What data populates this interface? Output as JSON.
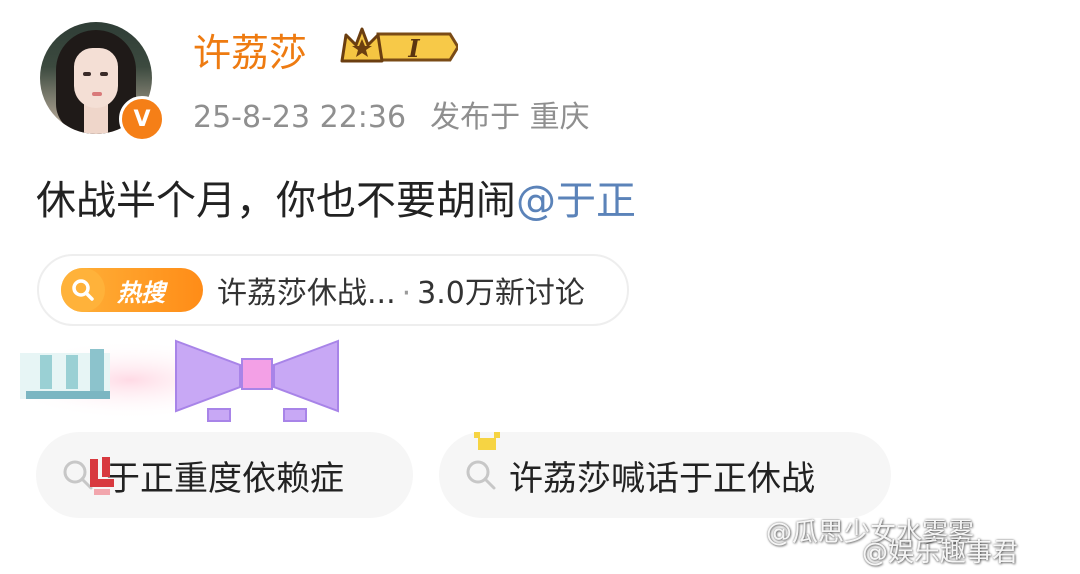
{
  "post": {
    "username": "许荔莎",
    "level_label": "I",
    "time": "25-8-23 22:36",
    "location": "发布于 重庆",
    "verified_symbol": "V",
    "text_main": "休战半个月，你也不要胡闹",
    "mention": "@于正"
  },
  "hot_search": {
    "badge_label": "热搜",
    "title": "许荔莎休战...",
    "separator": "·",
    "discussion": "3.0万新讨论"
  },
  "related": [
    {
      "text": "于正重度依赖症"
    },
    {
      "text": "许荔莎喊话于正休战"
    }
  ],
  "watermarks": {
    "line1": "@瓜思少女水雾雾",
    "line2": "@娱乐趣事君"
  },
  "colors": {
    "username": "#ee7b11",
    "mention": "#5b83b9",
    "hot_badge": "#ff9b1f",
    "verified": "#f57f17"
  },
  "icons": [
    "verified-icon",
    "crown-level-icon",
    "search-icon"
  ]
}
